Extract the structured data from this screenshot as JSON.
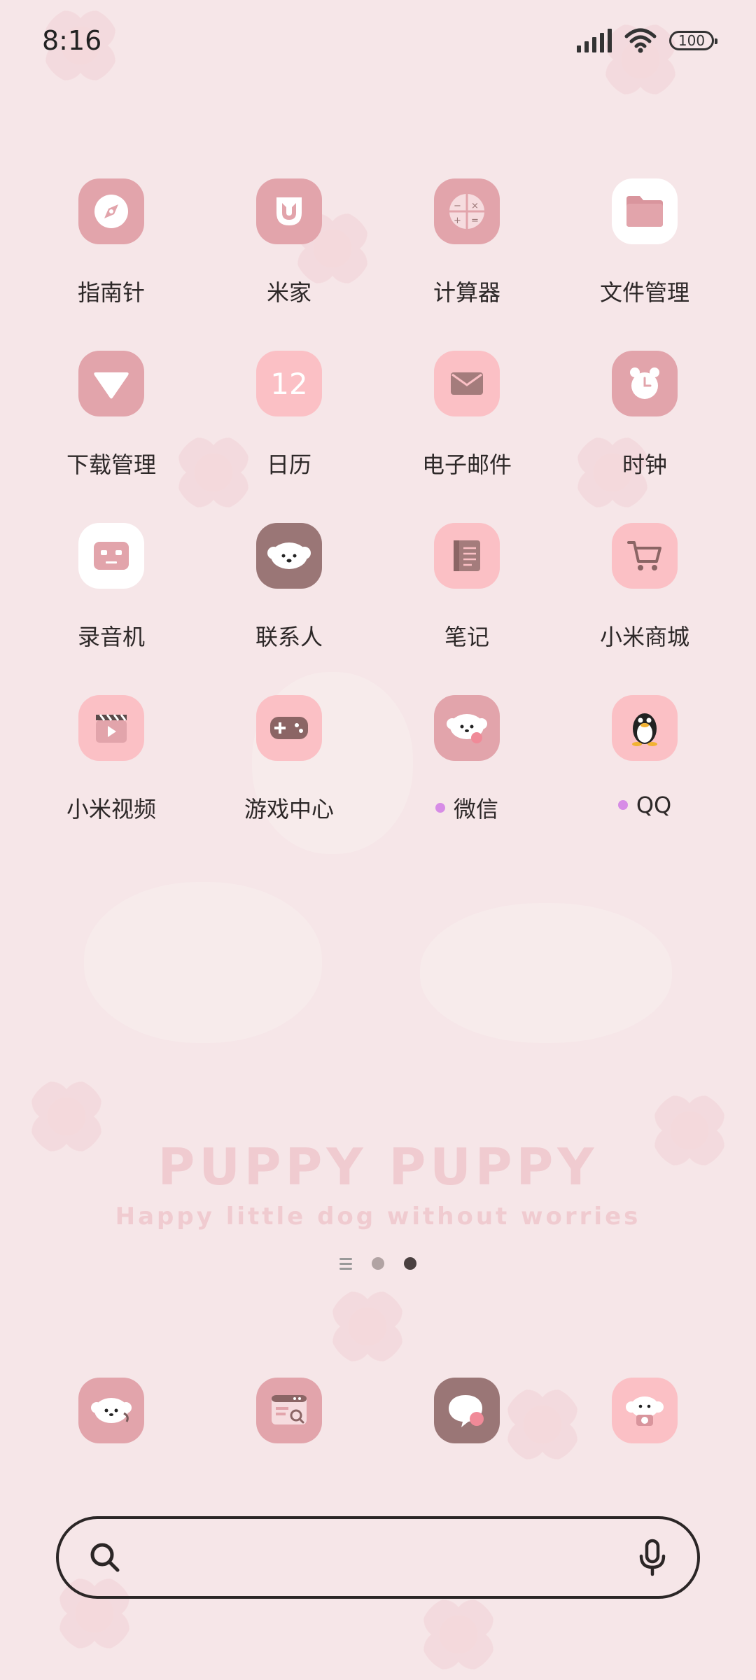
{
  "status_bar": {
    "time": "8:16",
    "battery": "100"
  },
  "apps": [
    {
      "name": "指南针",
      "icon": "compass-icon",
      "dot": false
    },
    {
      "name": "米家",
      "icon": "mijia-icon",
      "dot": false
    },
    {
      "name": "计算器",
      "icon": "calculator-icon",
      "dot": false
    },
    {
      "name": "文件管理",
      "icon": "folder-icon",
      "dot": false
    },
    {
      "name": "下载管理",
      "icon": "download-icon",
      "dot": false
    },
    {
      "name": "日历",
      "icon": "calendar-icon",
      "dot": false,
      "icon_text": "12"
    },
    {
      "name": "电子邮件",
      "icon": "mail-icon",
      "dot": false
    },
    {
      "name": "时钟",
      "icon": "clock-icon",
      "dot": false
    },
    {
      "name": "录音机",
      "icon": "recorder-icon",
      "dot": false
    },
    {
      "name": "联系人",
      "icon": "contacts-icon",
      "dot": false
    },
    {
      "name": "笔记",
      "icon": "notes-icon",
      "dot": false
    },
    {
      "name": "小米商城",
      "icon": "cart-icon",
      "dot": false
    },
    {
      "name": "小米视频",
      "icon": "video-icon",
      "dot": false
    },
    {
      "name": "游戏中心",
      "icon": "gamepad-icon",
      "dot": false
    },
    {
      "name": "微信",
      "icon": "wechat-icon",
      "dot": true
    },
    {
      "name": "QQ",
      "icon": "qq-penguin-icon",
      "dot": true
    }
  ],
  "dock": [
    {
      "icon": "phone-puppy-icon"
    },
    {
      "icon": "browser-icon"
    },
    {
      "icon": "messages-icon"
    },
    {
      "icon": "camera-puppy-icon"
    }
  ],
  "wallpaper": {
    "title": "PUPPY PUPPY",
    "subtitle": "Happy little dog without worries"
  },
  "page_indicator": {
    "pages": 2,
    "active": 2
  },
  "colors": {
    "background": "#f6e6e8",
    "icon_rose": "#e2a4ab",
    "icon_light": "#fbc0c5",
    "notification_dot": "#d78ce6"
  }
}
